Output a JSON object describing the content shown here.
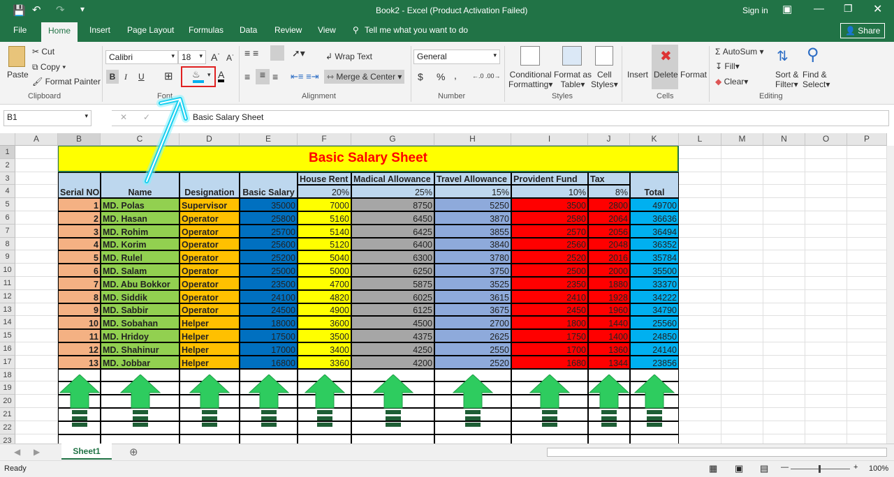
{
  "window": {
    "title": "Book2 - Excel (Product Activation Failed)",
    "sign_in": "Sign in",
    "share": "Share"
  },
  "tabs": [
    "File",
    "Home",
    "Insert",
    "Page Layout",
    "Formulas",
    "Data",
    "Review",
    "View"
  ],
  "tell_me": "Tell me what you want to do",
  "ribbon": {
    "clipboard": {
      "paste": "Paste",
      "cut": "Cut",
      "copy": "Copy",
      "format_painter": "Format Painter",
      "label": "Clipboard"
    },
    "font": {
      "name": "Calibri",
      "size": "18",
      "label": "Font",
      "bold": "B",
      "italic": "I",
      "underline": "U",
      "fill_color": "#00b0f0",
      "font_color": "#000000"
    },
    "alignment": {
      "wrap": "Wrap Text",
      "merge": "Merge & Center",
      "label": "Alignment"
    },
    "number": {
      "format": "General",
      "currency": "$",
      "percent": "%",
      "comma": ",",
      "label": "Number"
    },
    "styles": {
      "cond": "Conditional",
      "cond2": "Formatting",
      "table": "Format as",
      "table2": "Table",
      "cell": "Cell",
      "cell2": "Styles",
      "label": "Styles"
    },
    "cells": {
      "insert": "Insert",
      "delete": "Delete",
      "format": "Format",
      "label": "Cells"
    },
    "editing": {
      "autosum": "AutoSum",
      "fill": "Fill",
      "clear": "Clear",
      "sort": "Sort &",
      "sort2": "Filter",
      "find": "Find &",
      "find2": "Select",
      "label": "Editing"
    }
  },
  "formula_bar": {
    "name_box": "B1",
    "formula": "Basic Salary Sheet"
  },
  "columns": [
    "A",
    "B",
    "C",
    "D",
    "E",
    "F",
    "G",
    "H",
    "I",
    "J",
    "K",
    "L",
    "M",
    "N",
    "O",
    "P"
  ],
  "rows": [
    "1",
    "2",
    "3",
    "4",
    "5",
    "6",
    "7",
    "8",
    "9",
    "10",
    "11",
    "12",
    "13",
    "14",
    "15",
    "16",
    "17",
    "18",
    "19",
    "20",
    "21",
    "22",
    "23"
  ],
  "sheet": {
    "title": "Basic Salary Sheet",
    "headers": {
      "serial": "Serial NO.",
      "name": "Name",
      "designation": "Designation",
      "basic": "Basic Salary",
      "house": "House Rent",
      "medical": "Madical Allowance",
      "travel": "Travel Allowance",
      "pf": "Provident Fund",
      "tax": "Tax",
      "total": "Total"
    },
    "rates": {
      "house": "20%",
      "medical": "25%",
      "travel": "15%",
      "pf": "10%",
      "tax": "8%"
    },
    "records": [
      [
        "1",
        "MD. Polas",
        "Supervisor",
        "35000",
        "7000",
        "8750",
        "5250",
        "3500",
        "2800",
        "49700"
      ],
      [
        "2",
        "MD. Hasan",
        "Operator",
        "25800",
        "5160",
        "6450",
        "3870",
        "2580",
        "2064",
        "36636"
      ],
      [
        "3",
        "MD. Rohim",
        "Operator",
        "25700",
        "5140",
        "6425",
        "3855",
        "2570",
        "2056",
        "36494"
      ],
      [
        "4",
        "MD. Korim",
        "Operator",
        "25600",
        "5120",
        "6400",
        "3840",
        "2560",
        "2048",
        "36352"
      ],
      [
        "5",
        "MD. Rulel",
        "Operator",
        "25200",
        "5040",
        "6300",
        "3780",
        "2520",
        "2016",
        "35784"
      ],
      [
        "6",
        "MD. Salam",
        "Operator",
        "25000",
        "5000",
        "6250",
        "3750",
        "2500",
        "2000",
        "35500"
      ],
      [
        "7",
        "MD. Abu Bokkor",
        "Operator",
        "23500",
        "4700",
        "5875",
        "3525",
        "2350",
        "1880",
        "33370"
      ],
      [
        "8",
        "MD. Siddik",
        "Operator",
        "24100",
        "4820",
        "6025",
        "3615",
        "2410",
        "1928",
        "34222"
      ],
      [
        "9",
        "MD. Sabbir",
        "Operator",
        "24500",
        "4900",
        "6125",
        "3675",
        "2450",
        "1960",
        "34790"
      ],
      [
        "10",
        "MD. Sobahan",
        "Helper",
        "18000",
        "3600",
        "4500",
        "2700",
        "1800",
        "1440",
        "25560"
      ],
      [
        "11",
        "MD. Hridoy",
        "Helper",
        "17500",
        "3500",
        "4375",
        "2625",
        "1750",
        "1400",
        "24850"
      ],
      [
        "12",
        "MD. Shahinur",
        "Helper",
        "17000",
        "3400",
        "4250",
        "2550",
        "1700",
        "1360",
        "24140"
      ],
      [
        "13",
        "MD. Jobbar",
        "Helper",
        "16800",
        "3360",
        "4200",
        "2520",
        "1680",
        "1344",
        "23856"
      ]
    ],
    "column_colors": [
      "#f4b183",
      "#92d050",
      "#ffc000",
      "#0070c0",
      "#ffff00",
      "#a6a6a6",
      "#8eaadb",
      "#ff0000",
      "#ff0000",
      "#00b0f0"
    ],
    "title_fill": "#ffff00",
    "title_color": "#ff0000",
    "header_fill": "#bdd7ee"
  },
  "sheet_tab": "Sheet1",
  "status": {
    "ready": "Ready",
    "zoom": "100%"
  }
}
